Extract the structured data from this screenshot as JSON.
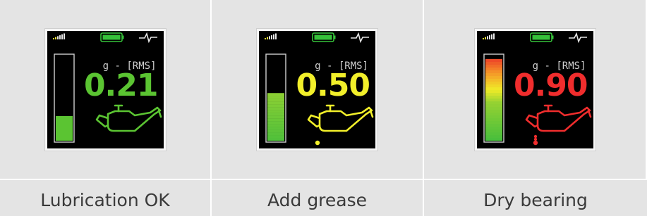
{
  "panels": [
    {
      "unit": "g - [RMS]",
      "value": "0.21",
      "color": "#5bc432",
      "bar_level": 0.29,
      "bar_style": "single",
      "drip": false,
      "status": "Lubrication OK"
    },
    {
      "unit": "g - [RMS]",
      "value": "0.50",
      "color": "#f2ef2a",
      "bar_level": 0.56,
      "bar_style": "gradient",
      "drip": true,
      "status": "Add grease"
    },
    {
      "unit": "g - [RMS]",
      "value": "0.90",
      "color": "#f02d2d",
      "bar_level": 0.96,
      "bar_style": "gradient",
      "drip": true,
      "status": "Dry bearing"
    }
  ],
  "icons": {
    "signal": "signal-strength-icon",
    "battery": "battery-icon",
    "pulse": "pulse-icon",
    "oil_can": "oil-can-icon"
  },
  "colors": {
    "battery": "#36c23a",
    "screen": "#000000",
    "icon_fg": "#e6e6e6"
  }
}
